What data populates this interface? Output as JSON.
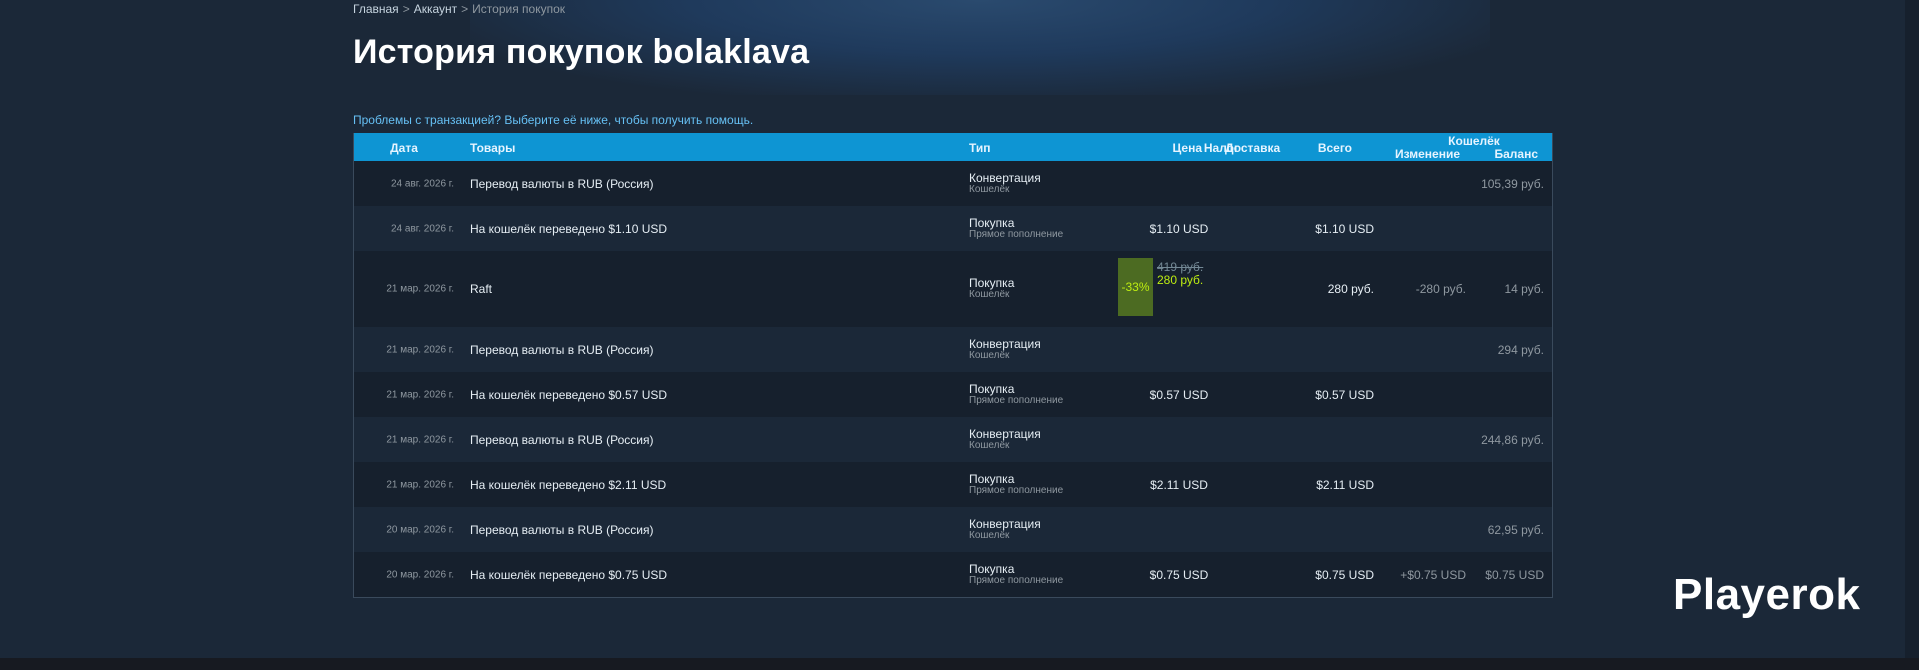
{
  "breadcrumb": {
    "home": "Главная",
    "account": "Аккаунт",
    "current": "История покупок",
    "separator": ">"
  },
  "page_title": "История покупок bolaklava",
  "help_link": "Проблемы с транзакцией? Выберите её ниже, чтобы получить помощь.",
  "table": {
    "headers": {
      "date": "Дата",
      "items": "Товары",
      "type": "Тип",
      "price": "Цена",
      "tax": "Налог",
      "shipping": "Доставка",
      "total": "Всего",
      "wallet": "Кошелёк",
      "change": "Изменение",
      "balance": "Баланс"
    },
    "rows": [
      {
        "date": "24 авг. 2026 г.",
        "item": "Перевод валюты в RUB (Россия)",
        "type": "Конвертация",
        "subtype": "Кошелёк",
        "price": "",
        "total": "",
        "change": "",
        "balance": "105,39 руб."
      },
      {
        "date": "24 авг. 2026 г.",
        "item": "На кошелёк переведено $1.10 USD",
        "type": "Покупка",
        "subtype": "Прямое пополнение",
        "price": "$1.10 USD",
        "total": "$1.10 USD",
        "change": "",
        "balance": ""
      },
      {
        "date": "21 мар. 2026 г.",
        "item": "Raft",
        "type": "Покупка",
        "subtype": "Кошелёк",
        "discount": "-33%",
        "original_price": "419 руб.",
        "final_price": "280 руб.",
        "total": "280 руб.",
        "change": "-280 руб.",
        "balance": "14 руб."
      },
      {
        "date": "21 мар. 2026 г.",
        "item": "Перевод валюты в RUB (Россия)",
        "type": "Конвертация",
        "subtype": "Кошелёк",
        "price": "",
        "total": "",
        "change": "",
        "balance": "294 руб."
      },
      {
        "date": "21 мар. 2026 г.",
        "item": "На кошелёк переведено $0.57 USD",
        "type": "Покупка",
        "subtype": "Прямое пополнение",
        "price": "$0.57 USD",
        "total": "$0.57 USD",
        "change": "",
        "balance": ""
      },
      {
        "date": "21 мар. 2026 г.",
        "item": "Перевод валюты в RUB (Россия)",
        "type": "Конвертация",
        "subtype": "Кошелёк",
        "price": "",
        "total": "",
        "change": "",
        "balance": "244,86 руб."
      },
      {
        "date": "21 мар. 2026 г.",
        "item": "На кошелёк переведено $2.11 USD",
        "type": "Покупка",
        "subtype": "Прямое пополнение",
        "price": "$2.11 USD",
        "total": "$2.11 USD",
        "change": "",
        "balance": ""
      },
      {
        "date": "20 мар. 2026 г.",
        "item": "Перевод валюты в RUB (Россия)",
        "type": "Конвертация",
        "subtype": "Кошелёк",
        "price": "",
        "total": "",
        "change": "",
        "balance": "62,95 руб."
      },
      {
        "date": "20 мар. 2026 г.",
        "item": "На кошелёк переведено $0.75 USD",
        "type": "Покупка",
        "subtype": "Прямое пополнение",
        "price": "$0.75 USD",
        "total": "$0.75 USD",
        "change": "+$0.75 USD",
        "balance": "$0.75 USD"
      }
    ]
  },
  "watermark": "Playerok",
  "colors": {
    "background": "#1b2838",
    "header": "#0e95d3",
    "link": "#66c0f4",
    "discount_bg": "#4c6b22",
    "discount_text": "#beee11"
  }
}
